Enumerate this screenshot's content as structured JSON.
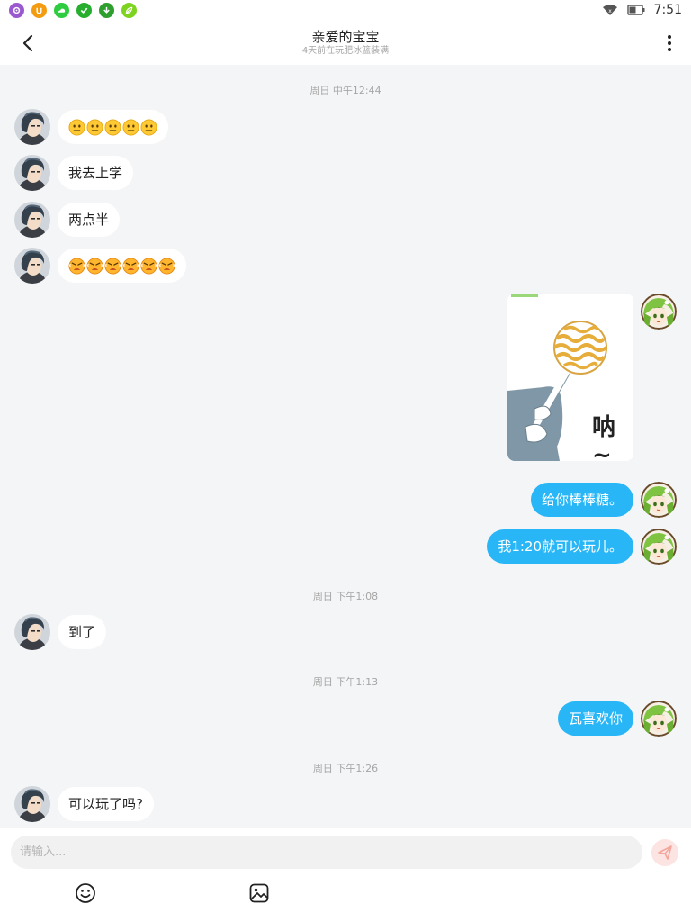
{
  "status_bar": {
    "time": "7:51",
    "app_icons": [
      "settings-icon",
      "u-app-icon",
      "cloud-app-icon",
      "check-app-icon",
      "download-app-icon",
      "leaf-app-icon"
    ],
    "app_colors": [
      "#9b59d0",
      "#f39c12",
      "#2ecc40",
      "#27ae2e",
      "#2e9e2e",
      "#7ed321"
    ]
  },
  "header": {
    "title": "亲爱的宝宝",
    "subtitle": "4天前在玩肥冰篮装满"
  },
  "messages": [
    {
      "type": "timestamp",
      "text": "周日 中午12:44"
    },
    {
      "type": "emoji",
      "side": "left",
      "emoji": "neutral-face",
      "count": 5
    },
    {
      "type": "text",
      "side": "left",
      "text": "我去上学"
    },
    {
      "type": "text",
      "side": "left",
      "text": "两点半"
    },
    {
      "type": "emoji",
      "side": "left",
      "emoji": "angry-face",
      "count": 6
    },
    {
      "type": "sticker",
      "side": "right",
      "text": "呐~"
    },
    {
      "type": "text",
      "side": "right",
      "text": "给你棒棒糖。"
    },
    {
      "type": "text",
      "side": "right",
      "text": "我1:20就可以玩儿。"
    },
    {
      "type": "timestamp",
      "text": "周日 下午1:08"
    },
    {
      "type": "text",
      "side": "left",
      "text": "到了"
    },
    {
      "type": "timestamp",
      "text": "周日 下午1:13"
    },
    {
      "type": "text",
      "side": "right",
      "text": "瓦喜欢你"
    },
    {
      "type": "timestamp",
      "text": "周日 下午1:26"
    },
    {
      "type": "text",
      "side": "left",
      "text": "可以玩了吗?"
    }
  ],
  "input": {
    "placeholder": "请输入...",
    "value": ""
  },
  "colors": {
    "outgoing_bubble": "#29b6f6",
    "incoming_bubble": "#ffffff",
    "background": "#f4f5f7",
    "send_button": "#fbe4e2"
  }
}
